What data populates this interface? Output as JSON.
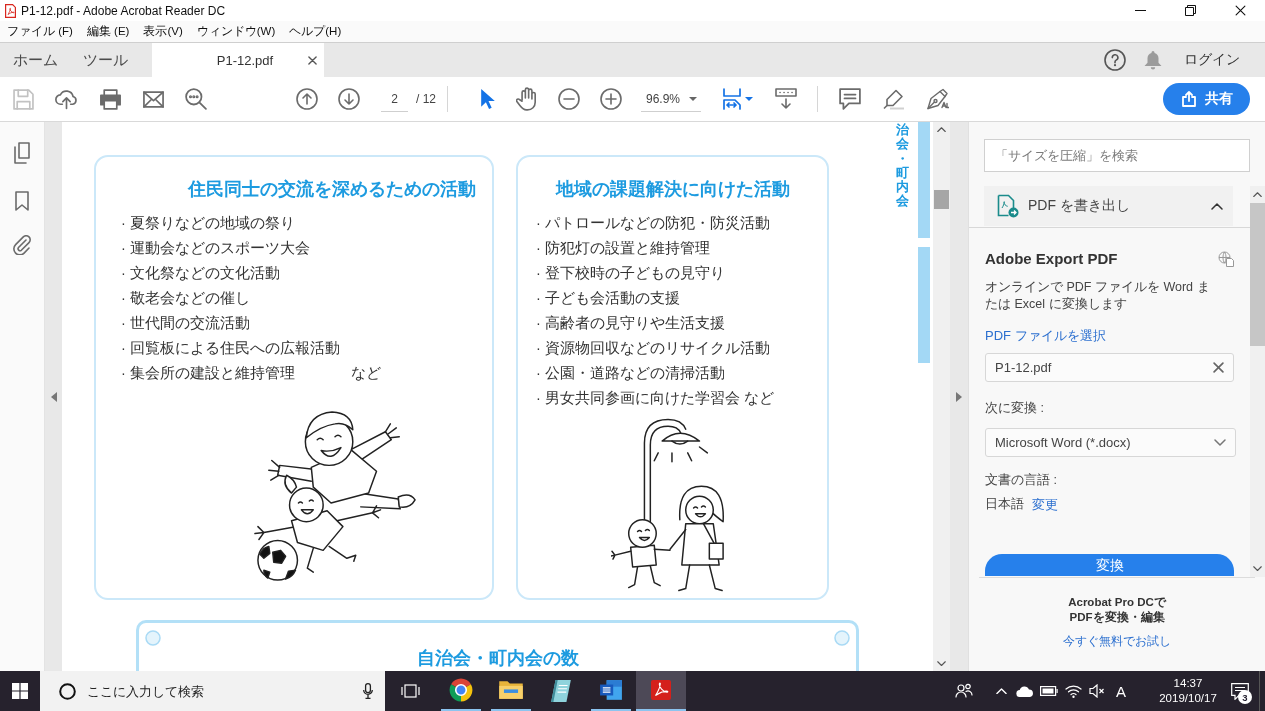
{
  "window": {
    "title": "P1-12.pdf - Adobe Acrobat Reader DC"
  },
  "menu": [
    "ファイル (F)",
    "編集 (E)",
    "表示(V)",
    "ウィンドウ(W)",
    "ヘルプ(H)"
  ],
  "tabs": [
    {
      "label": "ホーム",
      "selected": false,
      "closable": false
    },
    {
      "label": "ツール",
      "selected": false,
      "closable": false
    },
    {
      "label": "P1-12.pdf",
      "selected": true,
      "closable": true
    }
  ],
  "account": {
    "login": "ログイン"
  },
  "toolbar": {
    "file_tools": [
      {
        "kind": "save",
        "disabled": true
      },
      {
        "kind": "upload",
        "disabled": false
      },
      {
        "kind": "print",
        "disabled": false
      },
      {
        "kind": "mail",
        "disabled": false
      },
      {
        "kind": "find",
        "disabled": false
      }
    ],
    "page": {
      "value": "2",
      "total": "/ 12"
    },
    "pointer_tools": [
      {
        "kind": "select",
        "selected": true
      },
      {
        "kind": "hand",
        "selected": false
      }
    ],
    "zoom": {
      "value": "96.9%"
    },
    "share": "共有"
  },
  "document": {
    "side_tab": "治会・町内会",
    "cards": [
      {
        "title": "住民同士の交流を深めるための活動",
        "items": [
          "· 夏祭りなどの地域の祭り",
          "· 運動会などのスポーツ大会",
          "· 文化祭などの文化活動",
          "· 敬老会などの催し",
          "· 世代間の交流活動",
          "· 回覧板による住民への広報活動",
          "· 集会所の建設と維持管理"
        ],
        "note": "など",
        "illustration": {
          "kind": "soccer"
        }
      },
      {
        "title": "地域の課題解決に向けた活動",
        "items": [
          "· パトロールなどの防犯・防災活動",
          "· 防犯灯の設置と維持管理",
          "· 登下校時の子どもの見守り",
          "· 子ども会活動の支援",
          "· 高齢者の見守りや生活支援",
          "· 資源物回収などのリサイクル活動",
          "· 公園・道路などの清掃活動",
          "· 男女共同参画に向けた学習会 など"
        ],
        "illustration": {
          "kind": "streetlight"
        }
      }
    ],
    "summary_title": "自治会・町内会の数"
  },
  "tools_pane": {
    "search": {
      "placeholder": "「サイズを圧縮」を検索"
    },
    "section": {
      "title": "PDF を書き出し",
      "expanded": true
    },
    "heading": "Adobe Export PDF",
    "description": "オンラインで PDF ファイルを Word または Excel に変換します",
    "select_link": "PDF ファイルを選択",
    "file": {
      "value": "P1-12.pdf"
    },
    "convert_label": "次に変換 :",
    "format": {
      "value": "Microsoft Word (*.docx)"
    },
    "language_label": "文書の言語 :",
    "language": "日本語",
    "change_link": "変更",
    "convert_button": "変換",
    "promo": {
      "title": "Acrobat Pro DCで",
      "subtitle": "PDFを変換・編集",
      "link": "今すぐ無料でお試し"
    }
  },
  "taskbar": {
    "search": {
      "placeholder": "ここに入力して検索"
    },
    "apps": [
      {
        "kind": "browser",
        "running": true,
        "active": false
      },
      {
        "kind": "folder",
        "running": true,
        "active": false
      },
      {
        "kind": "notebook",
        "running": false,
        "active": false
      },
      {
        "kind": "word",
        "running": true,
        "active": false
      },
      {
        "kind": "acrobat",
        "running": true,
        "active": true
      }
    ],
    "ime": "A",
    "time": "14:37",
    "date": "2019/10/17",
    "notifications": "3"
  }
}
